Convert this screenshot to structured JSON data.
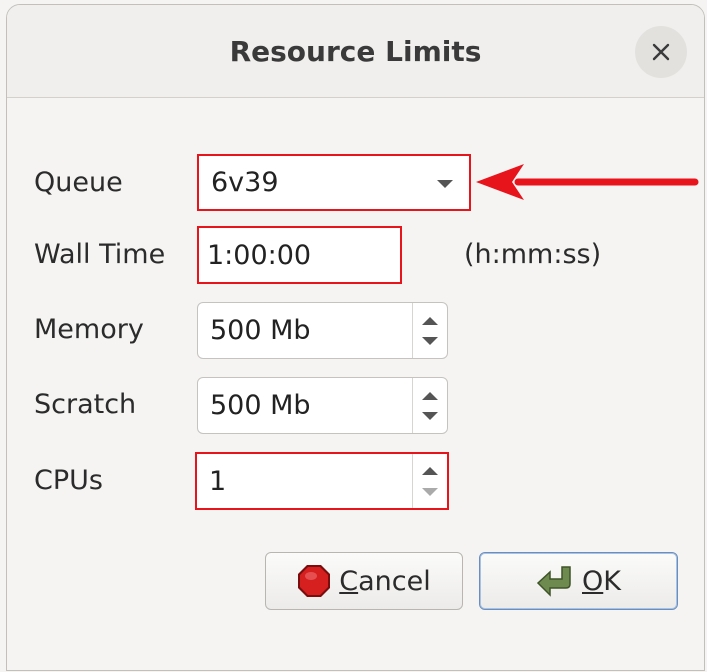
{
  "dialog": {
    "title": "Resource Limits",
    "close_glyph": "×"
  },
  "form": {
    "queue": {
      "label": "Queue",
      "value": "6v39"
    },
    "wall_time": {
      "label": "Wall Time",
      "value": "1:00:00",
      "unit": "(h:mm:ss)"
    },
    "memory": {
      "label": "Memory",
      "value": "500 Mb"
    },
    "scratch": {
      "label": "Scratch",
      "value": "500 Mb"
    },
    "cpus": {
      "label": "CPUs",
      "value": "1"
    }
  },
  "buttons": {
    "cancel": {
      "mnemonic": "C",
      "rest": "ancel"
    },
    "ok": {
      "mnemonic": "O",
      "rest": "K"
    }
  },
  "colors": {
    "highlight": "#e8141c",
    "cancel_icon": "#d61f1f",
    "ok_icon": "#6f8a4f"
  },
  "icons": {
    "close": "close-icon",
    "dropdown": "chevron-down-icon",
    "cancel": "stop-icon",
    "ok": "green-return-arrow-icon",
    "annotation": "red-arrow-icon"
  }
}
